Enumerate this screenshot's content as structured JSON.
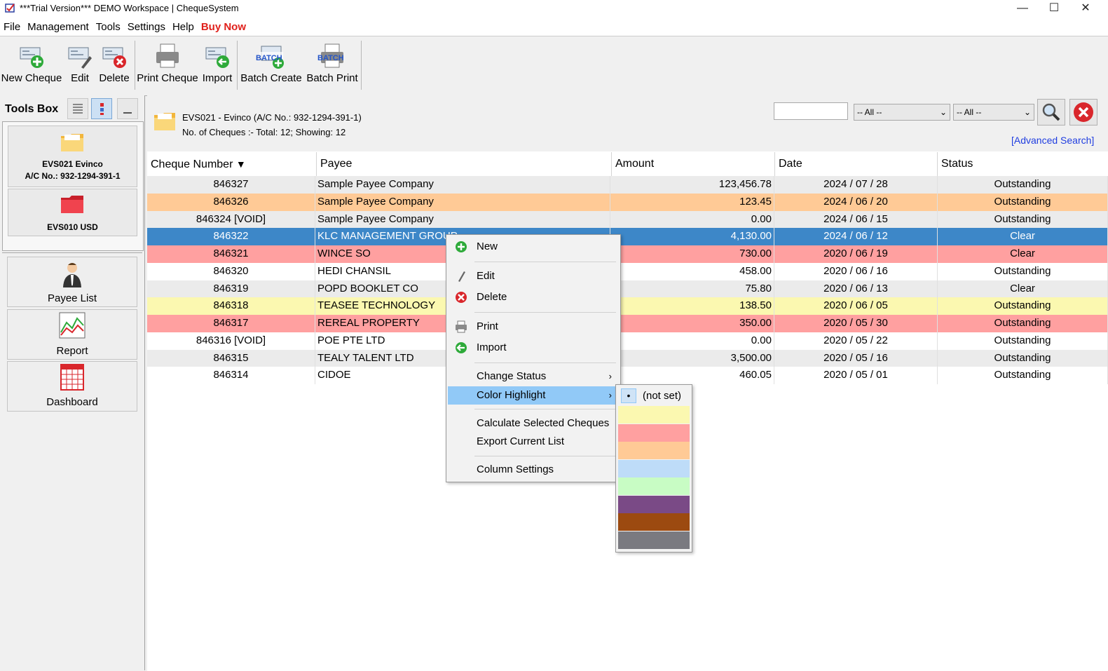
{
  "window": {
    "title": "***Trial Version*** DEMO Workspace | ChequeSystem",
    "minimize": "—",
    "maximize": "☐",
    "close": "✕"
  },
  "menu": [
    "File",
    "Management",
    "Tools",
    "Settings",
    "Help",
    "Buy Now"
  ],
  "toolbar": {
    "new_cheque": "New Cheque",
    "edit": "Edit",
    "delete": "Delete",
    "print_cheque": "Print Cheque",
    "import": "Import",
    "batch_create": "Batch Create",
    "batch_print": "Batch Print",
    "batch_badge": "BATCH"
  },
  "toolsbox": {
    "title": "Tools Box",
    "accounts": [
      {
        "line1": "EVS021 Evinco",
        "line2": "A/C No.: 932-1294-391-1",
        "color": "#f6c94c"
      },
      {
        "line1": "EVS010 USD",
        "line2": "",
        "color": "#e8333b"
      }
    ],
    "buttons": {
      "payee_list": "Payee List",
      "report": "Report",
      "dashboard": "Dashboard"
    }
  },
  "account_info": {
    "title": "EVS021 - Evinco (A/C No.: 932-1294-391-1)",
    "summary": "No. of Cheques :- Total: 12; Showing: 12"
  },
  "search": {
    "value": "",
    "filter1": "-- All --",
    "filter2": "-- All --",
    "advanced": "[Advanced Search]"
  },
  "table": {
    "headers": [
      "Cheque Number",
      "Payee",
      "Amount",
      "Date",
      "Status"
    ],
    "sort_indicator": "▼",
    "rows": [
      {
        "num": "846327",
        "payee": "Sample Payee Company",
        "amount": "123,456.78",
        "date": "2024 / 07 / 28",
        "status": "Outstanding",
        "bg": "#ebebeb",
        "fg": "#000000"
      },
      {
        "num": "846326",
        "payee": "Sample Payee Company",
        "amount": "123.45",
        "date": "2024 / 06 / 20",
        "status": "Outstanding",
        "bg": "#ffca96",
        "fg": "#000000"
      },
      {
        "num": "846324 [VOID]",
        "payee": "Sample Payee Company",
        "amount": "0.00",
        "date": "2024 / 06 / 15",
        "status": "Outstanding",
        "bg": "#ebebeb",
        "fg": "#000000"
      },
      {
        "num": "846322",
        "payee": "KLC MANAGEMENT GROUP",
        "amount": "4,130.00",
        "date": "2024 / 06 / 12",
        "status": "Clear",
        "bg": "#3d87c8",
        "fg": "#ffffff"
      },
      {
        "num": "846321",
        "payee": "WINCE SO",
        "amount": "730.00",
        "date": "2020 / 06 / 19",
        "status": "Clear",
        "bg": "#ffa0a0",
        "fg": "#000000"
      },
      {
        "num": "846320",
        "payee": "HEDI CHANSIL",
        "amount": "458.00",
        "date": "2020 / 06 / 16",
        "status": "Outstanding",
        "bg": "#ffffff",
        "fg": "#000000"
      },
      {
        "num": "846319",
        "payee": "POPD BOOKLET CO",
        "amount": "75.80",
        "date": "2020 / 06 / 13",
        "status": "Clear",
        "bg": "#ebebeb",
        "fg": "#000000"
      },
      {
        "num": "846318",
        "payee": "TEASEE TECHNOLOGY",
        "amount": "138.50",
        "date": "2020 / 06 / 05",
        "status": "Outstanding",
        "bg": "#fbf8b0",
        "fg": "#000000"
      },
      {
        "num": "846317",
        "payee": "REREAL PROPERTY",
        "amount": "350.00",
        "date": "2020 / 05 / 30",
        "status": "Outstanding",
        "bg": "#ffa0a0",
        "fg": "#000000"
      },
      {
        "num": "846316 [VOID]",
        "payee": "POE PTE LTD",
        "amount": "0.00",
        "date": "2020 / 05 / 22",
        "status": "Outstanding",
        "bg": "#ffffff",
        "fg": "#000000"
      },
      {
        "num": "846315",
        "payee": "TEALY TALENT LTD",
        "amount": "3,500.00",
        "date": "2020 / 05 / 16",
        "status": "Outstanding",
        "bg": "#ebebeb",
        "fg": "#000000"
      },
      {
        "num": "846314",
        "payee": "CIDOE",
        "amount": "460.05",
        "date": "2020 / 05 / 01",
        "status": "Outstanding",
        "bg": "#ffffff",
        "fg": "#000000"
      }
    ]
  },
  "context_menu": {
    "new": "New",
    "edit": "Edit",
    "delete": "Delete",
    "print": "Print",
    "import": "Import",
    "change_status": "Change Status",
    "color_highlight": "Color Highlight",
    "calculate": "Calculate Selected Cheques",
    "export": "Export Current List",
    "column_settings": "Column Settings",
    "submenu_arrow": "›"
  },
  "color_submenu": {
    "not_set": "(not set)",
    "swatches": [
      "#fbf8b0",
      "#ffa0a0",
      "#ffca96",
      "#bedcf8",
      "#c8fcc4",
      "#7a4a86",
      "#9c4a10",
      "#7a7a80"
    ]
  }
}
